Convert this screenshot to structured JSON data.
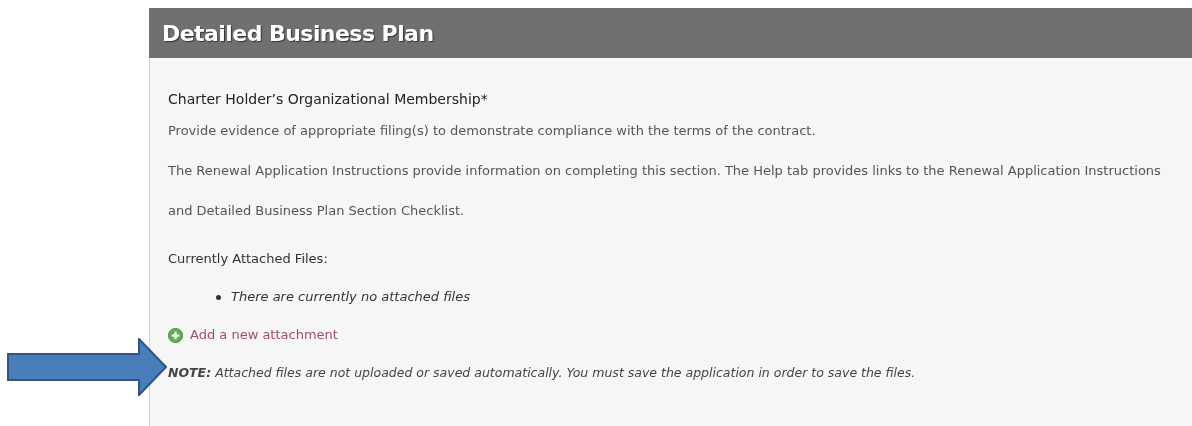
{
  "panel": {
    "title": "Detailed Business Plan"
  },
  "section": {
    "heading": "Charter Holder’s Organizational Membership*",
    "paragraphs": [
      "Provide evidence of appropriate filing(s) to demonstrate compliance with the terms of the contract.",
      "The Renewal Application Instructions provide information on completing this section. The Help tab provides links to the Renewal Application Instructions and Detailed Business Plan Section Checklist."
    ],
    "attached_label": "Currently Attached Files:",
    "attached_files": [
      "There are currently no attached files"
    ],
    "add_link": "Add a new attachment",
    "note": "**NOTE:** Attached files are not uploaded or saved automatically. You must save the application in order to save the files."
  }
}
